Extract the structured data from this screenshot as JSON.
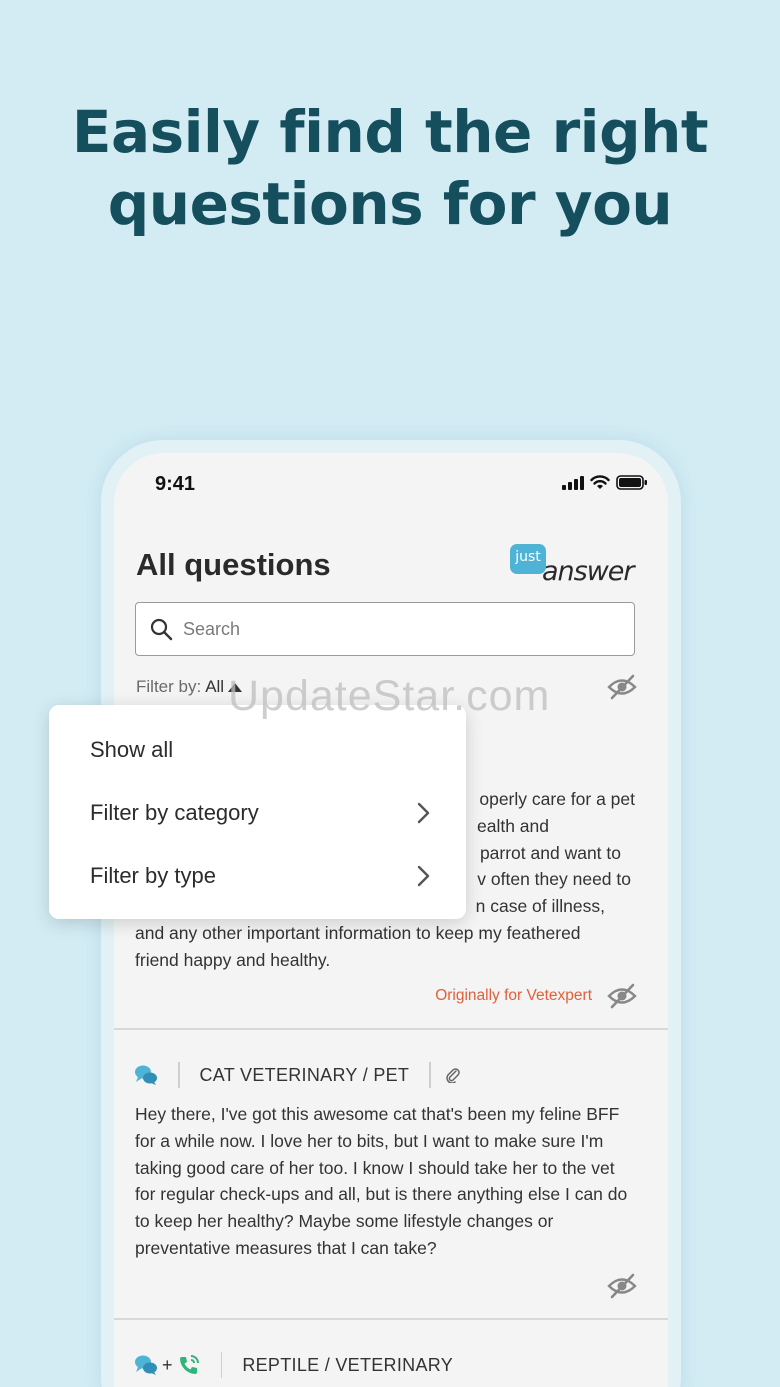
{
  "headline": {
    "line1": "Easily find the right",
    "line2": "questions for you"
  },
  "status_bar": {
    "time": "9:41"
  },
  "header": {
    "title": "All questions",
    "logo_top": "just",
    "logo_bottom": "answer"
  },
  "search": {
    "placeholder": "Search",
    "value": ""
  },
  "filter": {
    "label": "Filter by:",
    "value": "All"
  },
  "menu": {
    "items": [
      {
        "label": "Show all"
      },
      {
        "label": "Filter by category"
      },
      {
        "label": "Filter by type"
      }
    ]
  },
  "questions": [
    {
      "text_lines": [
        "operly care for a pet",
        "ealth and",
        "parrot and want to",
        "v often they need to",
        "n case of illness,",
        "and any other important information to keep my feathered",
        "friend happy and healthy."
      ],
      "origin": "Originally for Vetexpert"
    },
    {
      "category": "CAT VETERINARY / PET",
      "text": "Hey there, I've got this awesome cat that's been my feline BFF for a while now. I love her to bits, but I want to make sure I'm taking good care of her too. I know I should take her to the vet for regular check-ups and all, but is there anything else I can do to keep her healthy? Maybe some lifestyle changes or preventative measures that I can take?"
    },
    {
      "category": "REPTILE / VETERINARY",
      "plus": "+"
    }
  ],
  "watermark": "UpdateStar.com",
  "colors": {
    "background": "#d3ecf4",
    "headline": "#154e5c",
    "accent_blue": "#4fb3d5",
    "accent_green": "#2fb57a",
    "origin_text": "#e0603a"
  }
}
